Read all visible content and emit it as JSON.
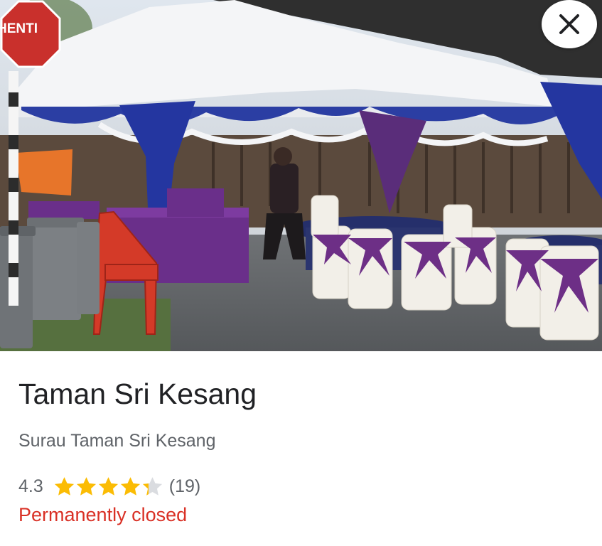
{
  "photo": {
    "description_icon": "place-photo",
    "sign_text": "HENTI"
  },
  "close_icon": "close-icon",
  "place": {
    "name": "Taman Sri Kesang",
    "subtitle": "Surau Taman Sri Kesang",
    "rating": "4.3",
    "rating_value": 4.3,
    "stars_max": 5,
    "review_count": "(19)",
    "status": "Permanently closed"
  },
  "colors": {
    "star": "#fbbc04",
    "star_empty": "#dadce0",
    "status": "#d93025",
    "title": "#202124",
    "secondary": "#5f6368"
  }
}
